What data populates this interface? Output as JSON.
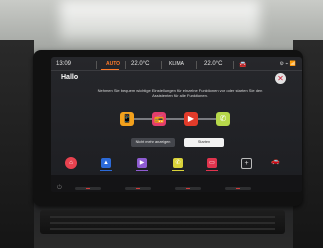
{
  "status_bar": {
    "time": "13:09",
    "auto_label": "AUTO",
    "temp_left": "22.0°C",
    "klima_label": "KLIMA",
    "temp_right": "22.0°C",
    "car_icon": "car-icon",
    "system_icons": "⚙ ⌁ 📶"
  },
  "welcome": {
    "greeting": "Hallo",
    "intro": "Nehmen Sie bequem wichtige Einstellungen für einzelne Funktionen vor oder starten Sie den Assistenten für alle Funktionen.",
    "close_symbol": "✕"
  },
  "shortcuts": [
    {
      "icon": "phone-icon",
      "glyph": "📱",
      "color": "#f3a11c"
    },
    {
      "icon": "radio-icon",
      "glyph": "📻",
      "color": "#e33d6c"
    },
    {
      "icon": "play-icon",
      "glyph": "▶",
      "color": "#e23b2a"
    },
    {
      "icon": "call-icon",
      "glyph": "✆",
      "color": "#b6d84a"
    }
  ],
  "buttons": {
    "skip": "Nicht mehr anzeigen",
    "start": "Starten"
  },
  "dock": [
    {
      "icon": "home-icon",
      "glyph": "⌂",
      "color": "#e8424f"
    },
    {
      "icon": "nav-icon",
      "glyph": "▲",
      "color": "#2c6ad8"
    },
    {
      "icon": "media-icon",
      "glyph": "▶",
      "color": "#8e5cd1"
    },
    {
      "icon": "phone-icon",
      "glyph": "✆",
      "color": "#d9d23a"
    },
    {
      "icon": "radio-icon",
      "glyph": "▭",
      "color": "#e0344d"
    },
    {
      "icon": "plus-icon",
      "glyph": "+"
    },
    {
      "icon": "car-settings-icon",
      "glyph": "🚗"
    }
  ]
}
